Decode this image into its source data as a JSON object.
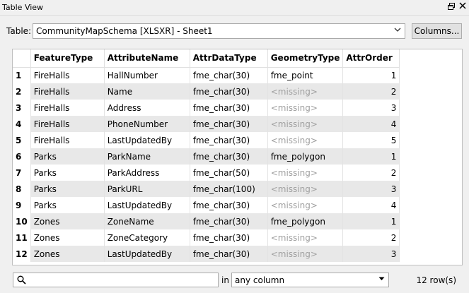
{
  "window": {
    "title": "Table View",
    "restore_icon": "restore-window-icon",
    "close_icon": "close-icon"
  },
  "table_selector": {
    "label": "Table:",
    "value": "CommunityMapSchema [XLSXR] - Sheet1",
    "columns_button": "Columns..."
  },
  "grid": {
    "headers": [
      "FeatureType",
      "AttributeName",
      "AttrDataType",
      "GeometryType",
      "AttrOrder"
    ],
    "rows": [
      {
        "n": "1",
        "FeatureType": "FireHalls",
        "AttributeName": "HallNumber",
        "AttrDataType": "fme_char(30)",
        "GeometryType": "fme_point",
        "AttrOrder": "1"
      },
      {
        "n": "2",
        "FeatureType": "FireHalls",
        "AttributeName": "Name",
        "AttrDataType": "fme_char(30)",
        "GeometryType": "<missing>",
        "AttrOrder": "2"
      },
      {
        "n": "3",
        "FeatureType": "FireHalls",
        "AttributeName": "Address",
        "AttrDataType": "fme_char(30)",
        "GeometryType": "<missing>",
        "AttrOrder": "3"
      },
      {
        "n": "4",
        "FeatureType": "FireHalls",
        "AttributeName": "PhoneNumber",
        "AttrDataType": "fme_char(30)",
        "GeometryType": "<missing>",
        "AttrOrder": "4"
      },
      {
        "n": "5",
        "FeatureType": "FireHalls",
        "AttributeName": "LastUpdatedBy",
        "AttrDataType": "fme_char(30)",
        "GeometryType": "<missing>",
        "AttrOrder": "5"
      },
      {
        "n": "6",
        "FeatureType": "Parks",
        "AttributeName": "ParkName",
        "AttrDataType": "fme_char(30)",
        "GeometryType": "fme_polygon",
        "AttrOrder": "1"
      },
      {
        "n": "7",
        "FeatureType": "Parks",
        "AttributeName": "ParkAddress",
        "AttrDataType": "fme_char(50)",
        "GeometryType": "<missing>",
        "AttrOrder": "2"
      },
      {
        "n": "8",
        "FeatureType": "Parks",
        "AttributeName": "ParkURL",
        "AttrDataType": "fme_char(100)",
        "GeometryType": "<missing>",
        "AttrOrder": "3"
      },
      {
        "n": "9",
        "FeatureType": "Parks",
        "AttributeName": "LastUpdatedBy",
        "AttrDataType": "fme_char(30)",
        "GeometryType": "<missing>",
        "AttrOrder": "4"
      },
      {
        "n": "10",
        "FeatureType": "Zones",
        "AttributeName": "ZoneName",
        "AttrDataType": "fme_char(30)",
        "GeometryType": "fme_polygon",
        "AttrOrder": "1"
      },
      {
        "n": "11",
        "FeatureType": "Zones",
        "AttributeName": "ZoneCategory",
        "AttrDataType": "fme_char(30)",
        "GeometryType": "<missing>",
        "AttrOrder": "2"
      },
      {
        "n": "12",
        "FeatureType": "Zones",
        "AttributeName": "LastUpdatedBy",
        "AttrDataType": "fme_char(30)",
        "GeometryType": "<missing>",
        "AttrOrder": "3"
      }
    ],
    "missing_color": "#a0a0a0",
    "alt_row_color": "#e8e8e8"
  },
  "footer": {
    "search_icon": "search-icon",
    "search_value": "",
    "in_label": "in",
    "column_filter": "any column",
    "row_count": "12 row(s)"
  }
}
